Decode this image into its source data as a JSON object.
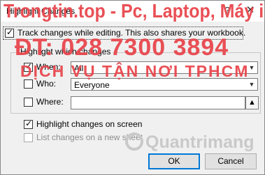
{
  "window": {
    "title": "Highlight Changes",
    "help_glyph": "?",
    "close_glyph": "✕"
  },
  "track_changes": {
    "checked": true,
    "label": "Track changes while editing. This also shares your workbook."
  },
  "group": {
    "title": "Highlight which changes",
    "when": {
      "checked": true,
      "label": "When:",
      "value": "All"
    },
    "who": {
      "checked": false,
      "label": "Who:",
      "value": "Everyone"
    },
    "where": {
      "checked": false,
      "label": "Where:",
      "value": ""
    }
  },
  "highlight_on_screen": {
    "checked": true,
    "label": "Highlight changes on screen"
  },
  "list_on_new_sheet": {
    "checked": false,
    "enabled": false,
    "label": "List changes on a new sheet"
  },
  "buttons": {
    "ok": "OK",
    "cancel": "Cancel"
  },
  "watermark": {
    "line1": "Trongtin.top - Pc, Laptop, Máy in",
    "line2": "ĐT: 028 7300 3894",
    "line3": "DỊCH VỤ TẬN NƠI TPHCM",
    "logo_text": "Quantrimang"
  },
  "colors": {
    "watermark_red": "#e8474d",
    "primary_button_border": "#0078d7",
    "dialog_background": "#f0f0f0"
  }
}
